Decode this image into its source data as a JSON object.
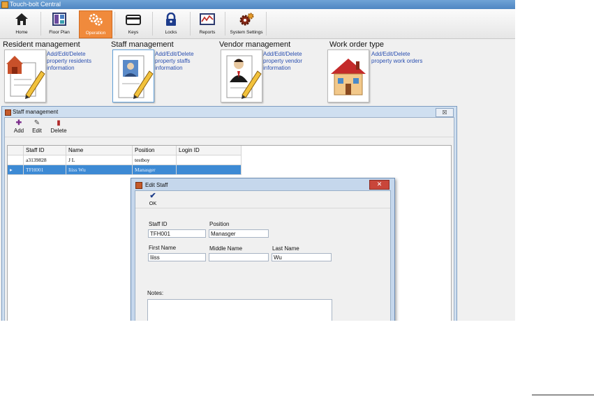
{
  "window": {
    "title": "Touch-bolt Central",
    "app_icon": "app-icon"
  },
  "toolbar": {
    "items": [
      {
        "label": "Home",
        "icon": "home-icon"
      },
      {
        "label": "Floor Plan",
        "icon": "floor-plan-icon"
      },
      {
        "label": "Operation",
        "icon": "operation-icon",
        "active": true
      },
      {
        "label": "Keys",
        "icon": "key-card-icon"
      },
      {
        "label": "Locks",
        "icon": "lock-icon"
      },
      {
        "label": "Reports",
        "icon": "reports-icon"
      },
      {
        "label": "System Settings",
        "icon": "settings-icon"
      }
    ],
    "accent_color": "#f08a3c"
  },
  "tiles": [
    {
      "title": "Resident management",
      "desc": [
        "Add/Edit/Delete",
        "property residents",
        "information"
      ],
      "icon": "resident-document-icon"
    },
    {
      "title": "Staff management",
      "desc": [
        "Add/Edit/Delete",
        "property staffs",
        "information"
      ],
      "icon": "staff-document-icon"
    },
    {
      "title": "Vendor management",
      "desc": [
        "Add/Edit/Delete",
        "property vendor",
        "information"
      ],
      "icon": "vendor-document-icon"
    },
    {
      "title": "Work order type",
      "desc": [
        "Add/Edit/Delete",
        "property work orders"
      ],
      "icon": "house-icon"
    }
  ],
  "staff_window": {
    "title": "Staff management",
    "close_label": "☒",
    "actions": [
      {
        "label": "Add",
        "icon": "plus-icon"
      },
      {
        "label": "Edit",
        "icon": "pencil-icon"
      },
      {
        "label": "Delete",
        "icon": "trash-icon"
      }
    ],
    "columns": [
      "Staff ID",
      "Name",
      "Position",
      "Login ID"
    ],
    "rows": [
      [
        "a3139828",
        "J L",
        "testboy",
        ""
      ],
      [
        "TFH001",
        "Iiiss  Wu",
        "Manasger",
        ""
      ]
    ],
    "selected_row": 1,
    "selection_color": "#3d8ad4"
  },
  "edit_dialog": {
    "title": "Edit Staff",
    "close_label": "✕",
    "ok_label": "OK",
    "fields": {
      "staff_id": {
        "label": "Staff ID",
        "value": "TFH001"
      },
      "position": {
        "label": "Position",
        "value": "Manasger"
      },
      "first_name": {
        "label": "First Name",
        "value": "Iiiss"
      },
      "middle_name": {
        "label": "Middle Name",
        "value": ""
      },
      "last_name": {
        "label": "Last Name",
        "value": "Wu"
      },
      "notes": {
        "label": "Notes:",
        "value": ""
      }
    }
  }
}
